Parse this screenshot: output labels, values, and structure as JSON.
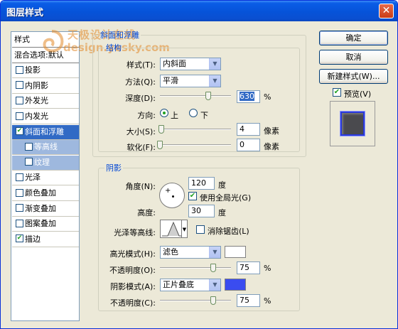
{
  "window": {
    "title": "图层样式",
    "close_glyph": "✕"
  },
  "watermark": {
    "line1": "天极设计在线",
    "line2": "design.yesky.com"
  },
  "sidebar": {
    "items": [
      {
        "label": "样式",
        "kind": "heading"
      },
      {
        "label": "混合选项:默认",
        "kind": "heading"
      },
      {
        "label": "投影",
        "checked": false
      },
      {
        "label": "内阴影",
        "checked": false
      },
      {
        "label": "外发光",
        "checked": false
      },
      {
        "label": "内发光",
        "checked": false
      },
      {
        "label": "斜面和浮雕",
        "checked": true,
        "selected": true
      },
      {
        "label": "等高线",
        "checked": false,
        "sub": true
      },
      {
        "label": "纹理",
        "checked": false,
        "sub": true
      },
      {
        "label": "光泽",
        "checked": false
      },
      {
        "label": "颜色叠加",
        "checked": false
      },
      {
        "label": "渐变叠加",
        "checked": false
      },
      {
        "label": "图案叠加",
        "checked": false
      },
      {
        "label": "描边",
        "checked": true
      }
    ]
  },
  "bevel": {
    "group_title": "斜面和浮雕",
    "structure_title": "结构",
    "style_label": "样式(T):",
    "style_value": "内斜面",
    "technique_label": "方法(Q):",
    "technique_value": "平滑",
    "depth_label": "深度(D):",
    "depth_value": "630",
    "depth_unit": "%",
    "depth_level": 0.68,
    "direction_label": "方向:",
    "direction_up": "上",
    "direction_down": "下",
    "size_label": "大小(S):",
    "size_value": "4",
    "size_unit": "像素",
    "size_level": 0.02,
    "soften_label": "软化(F):",
    "soften_value": "0",
    "soften_unit": "像素",
    "soften_level": 0.0
  },
  "shading": {
    "title": "阴影",
    "angle_label": "角度(N):",
    "angle_value": "120",
    "angle_unit": "度",
    "global_light_label": "使用全局光(G)",
    "global_light_checked": true,
    "altitude_label": "高度:",
    "altitude_value": "30",
    "altitude_unit": "度",
    "gloss_label": "光泽等高线:",
    "antialias_label": "消除锯齿(L)",
    "antialias_checked": false,
    "highlight_mode_label": "高光模式(H):",
    "highlight_mode_value": "滤色",
    "highlight_color": "#ffffff",
    "highlight_opacity_label": "不透明度(O):",
    "highlight_opacity_value": "75",
    "highlight_opacity_unit": "%",
    "highlight_opacity_level": 0.75,
    "shadow_mode_label": "阴影模式(A):",
    "shadow_mode_value": "正片叠底",
    "shadow_color": "#3a4cf0",
    "shadow_opacity_label": "不透明度(C):",
    "shadow_opacity_value": "75",
    "shadow_opacity_unit": "%",
    "shadow_opacity_level": 0.75
  },
  "buttons": {
    "ok": "确定",
    "cancel": "取消",
    "new_style": "新建样式(W)...",
    "preview_label": "预览(V)",
    "preview_checked": true
  }
}
